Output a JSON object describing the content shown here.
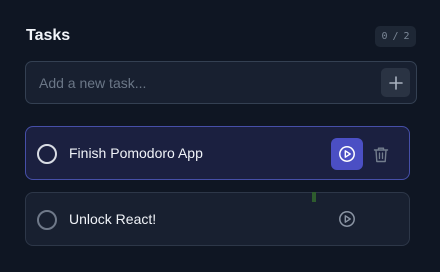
{
  "header": {
    "title": "Tasks",
    "counter": {
      "done": "0",
      "sep": "/",
      "total": "2"
    }
  },
  "add_task": {
    "placeholder": "Add a new task...",
    "value": ""
  },
  "tasks": [
    {
      "label": "Finish Pomodoro App",
      "completed": false,
      "active": true,
      "icons": [
        "circle-check",
        "play-icon",
        "trash-icon"
      ]
    },
    {
      "label": "Unlock React!",
      "completed": false,
      "active": false,
      "icons": [
        "circle-check",
        "play-icon"
      ]
    }
  ],
  "colors": {
    "background": "#0f1623",
    "card": "#182030",
    "active_card": "#1b2040",
    "active_border": "#464fa8",
    "accent": "#4b4fc4",
    "muted_text": "#6b7787"
  }
}
